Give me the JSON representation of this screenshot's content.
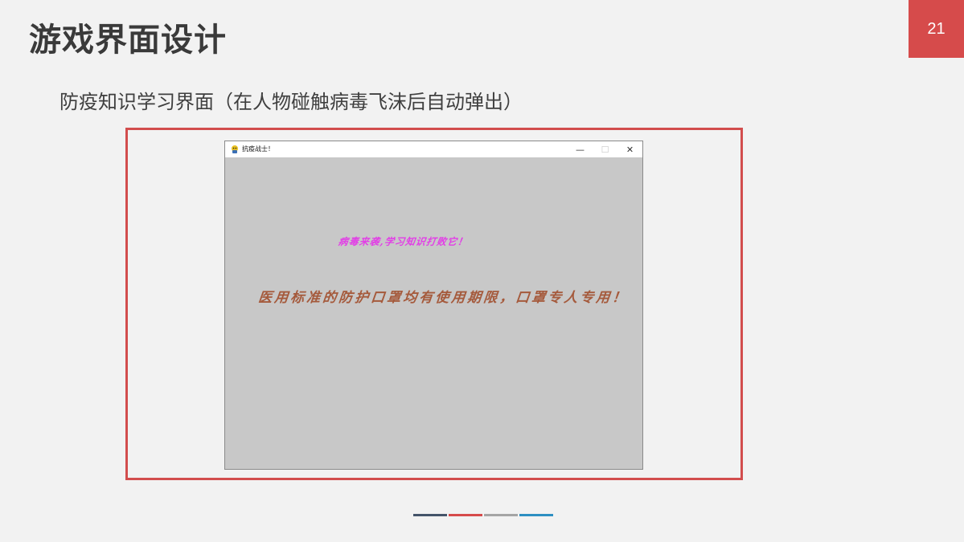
{
  "slide": {
    "title": "游戏界面设计",
    "page_number": "21",
    "subtitle": "防疫知识学习界面（在人物碰触病毒飞沫后自动弹出）"
  },
  "window": {
    "title": "抗疫战士！",
    "icon": "pygame-snake-icon",
    "minimize_icon": "minimize-icon",
    "maximize_icon": "maximize-icon",
    "close_icon": "close-icon",
    "minimize_glyph": "—",
    "maximize_glyph": "☐",
    "close_glyph": "✕"
  },
  "game": {
    "prompt": "病毒来袭,学习知识打败它！",
    "knowledge": "医用标准的防护口罩均有使用期限，口罩专人专用！"
  },
  "colors": {
    "accent_red": "#d64b4b",
    "canvas_bg": "#c8c8c8",
    "prompt_magenta": "#e23ee6",
    "knowledge_brown": "#a55a3c",
    "footer_bars": [
      "#44546a",
      "#d64b4b",
      "#a5a5a5",
      "#2e8fc2"
    ]
  }
}
